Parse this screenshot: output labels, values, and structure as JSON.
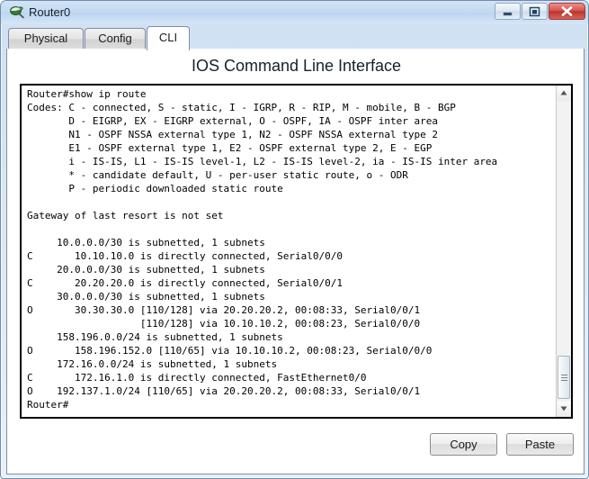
{
  "window": {
    "title": "Router0",
    "icon": "router-icon",
    "controls": {
      "minimize": "minimize-icon",
      "maximize": "maximize-icon",
      "close": "close-icon"
    }
  },
  "tabs": [
    {
      "label": "Physical",
      "active": false
    },
    {
      "label": "Config",
      "active": false
    },
    {
      "label": "CLI",
      "active": true
    }
  ],
  "cli": {
    "heading": "IOS Command Line Interface",
    "terminal_text": "Router#show ip route\nCodes: C - connected, S - static, I - IGRP, R - RIP, M - mobile, B - BGP\n       D - EIGRP, EX - EIGRP external, O - OSPF, IA - OSPF inter area\n       N1 - OSPF NSSA external type 1, N2 - OSPF NSSA external type 2\n       E1 - OSPF external type 1, E2 - OSPF external type 2, E - EGP\n       i - IS-IS, L1 - IS-IS level-1, L2 - IS-IS level-2, ia - IS-IS inter area\n       * - candidate default, U - per-user static route, o - ODR\n       P - periodic downloaded static route\n\nGateway of last resort is not set\n\n     10.0.0.0/30 is subnetted, 1 subnets\nC       10.10.10.0 is directly connected, Serial0/0/0\n     20.0.0.0/30 is subnetted, 1 subnets\nC       20.20.20.0 is directly connected, Serial0/0/1\n     30.0.0.0/30 is subnetted, 1 subnets\nO       30.30.30.0 [110/128] via 20.20.20.2, 00:08:33, Serial0/0/1\n                   [110/128] via 10.10.10.2, 00:08:23, Serial0/0/0\n     158.196.0.0/24 is subnetted, 1 subnets\nO       158.196.152.0 [110/65] via 10.10.10.2, 00:08:23, Serial0/0/0\n     172.16.0.0/24 is subnetted, 1 subnets\nC       172.16.1.0 is directly connected, FastEthernet0/0\nO    192.137.1.0/24 [110/65] via 20.20.20.2, 00:08:33, Serial0/0/1\nRouter#",
    "scrollbar": {
      "up_icon": "scroll-up-icon",
      "down_icon": "scroll-down-icon"
    }
  },
  "actions": {
    "copy_label": "Copy",
    "paste_label": "Paste"
  },
  "colors": {
    "title_bar": "#c3d9f1",
    "close_button": "#b8362e",
    "terminal_bg": "#ffffff",
    "terminal_fg": "#000000",
    "frame_border": "#6e8cb0"
  }
}
